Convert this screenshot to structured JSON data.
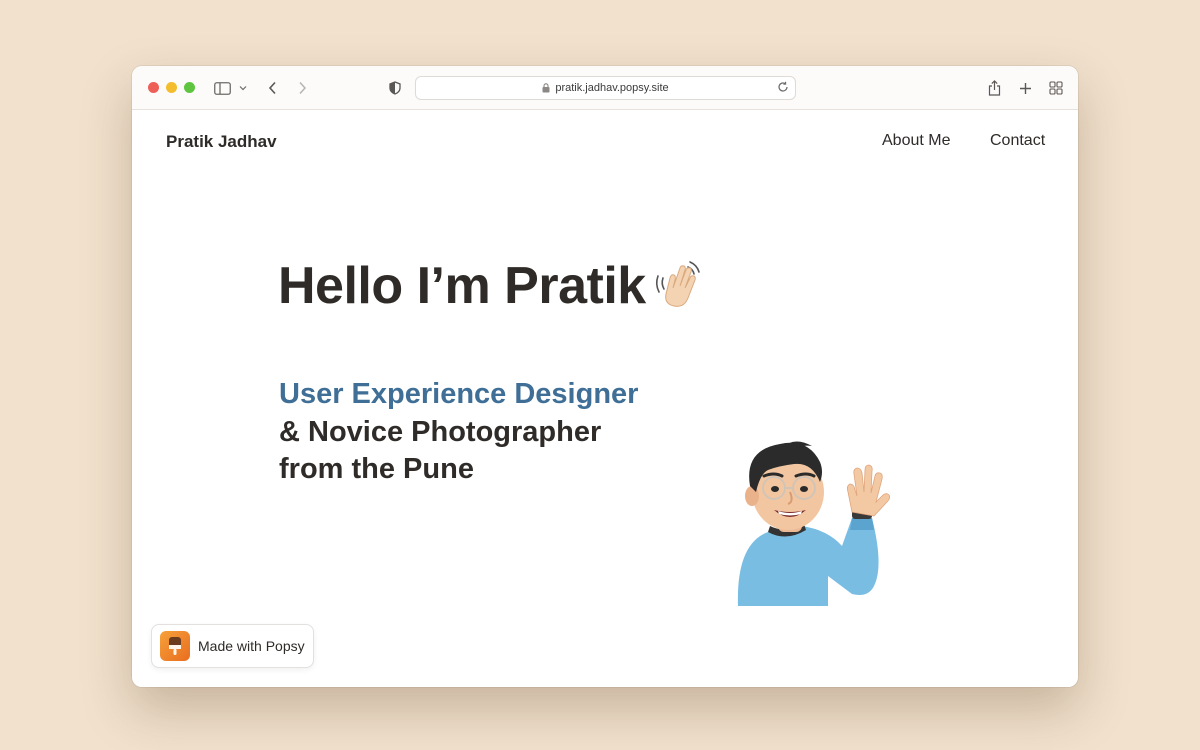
{
  "browser": {
    "url": "pratik.jadhav.popsy.site",
    "icons": {
      "sidebar": "sidebar-icon",
      "back": "chevron-left-icon",
      "forward": "chevron-right-icon",
      "privacy": "shield-icon",
      "lock": "lock-icon",
      "reload": "reload-icon",
      "share": "share-icon",
      "new_tab": "plus-icon",
      "tabs": "tab-overview-icon"
    }
  },
  "site": {
    "brand": "Pratik Jadhav",
    "nav": {
      "about": "About Me",
      "contact": "Contact"
    },
    "hero": {
      "greeting": "Hello I’m Pratik"
    },
    "tagline": {
      "line1": "User Experience Designer",
      "line2": "& Novice Photographer",
      "line3": "from the Pune"
    },
    "badge": {
      "label": "Made with Popsy"
    }
  },
  "colors": {
    "background": "#f1e1cd",
    "accent": "#3f6f96",
    "text": "#2f2b28",
    "badge_orange": "#f08a2d"
  }
}
